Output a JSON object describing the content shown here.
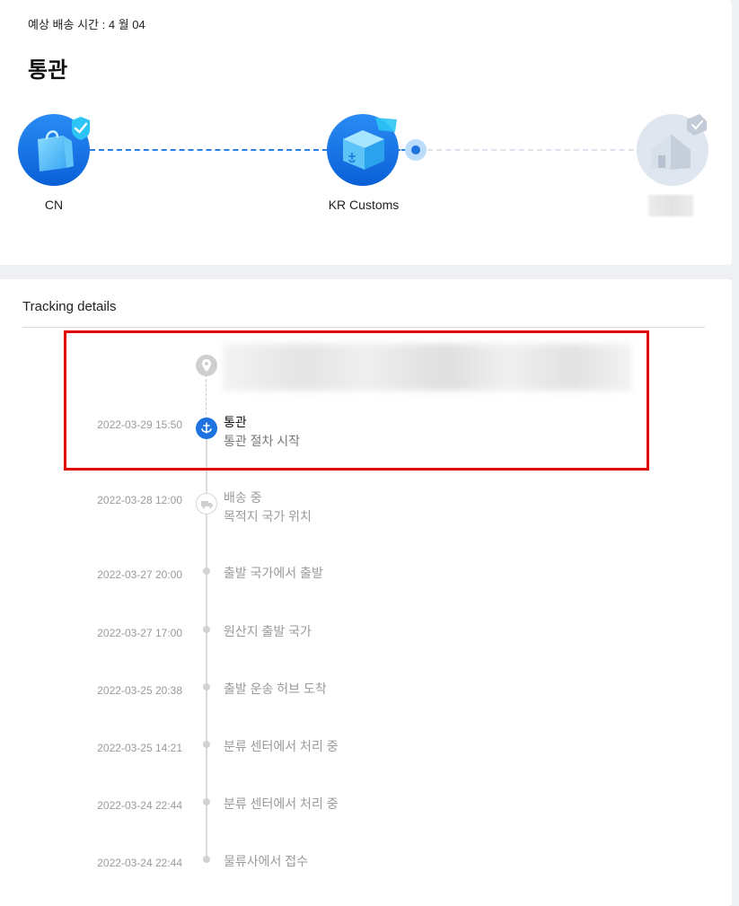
{
  "header": {
    "eta_text": "예상 배송 시간 : 4 월 04",
    "status_title": "통관"
  },
  "stages": [
    {
      "label": "CN",
      "icon": "shopping-bag-icon",
      "state": "done"
    },
    {
      "label": "KR Customs",
      "icon": "customs-package-icon",
      "state": "current"
    },
    {
      "label": "",
      "icon": "house-icon",
      "state": "pending"
    }
  ],
  "tracking": {
    "title": "Tracking details",
    "events": [
      {
        "time": "2022-03-29 15:50",
        "title": "통관",
        "sub": "통관 절차 시작",
        "icon": "anchor-icon",
        "active": true
      },
      {
        "time": "2022-03-28 12:00",
        "title": "배송 중",
        "sub": "목적지 국가 위치",
        "icon": "truck-icon",
        "active": false
      },
      {
        "time": "2022-03-27 20:00",
        "title": "출발 국가에서 출발",
        "sub": "",
        "active": false
      },
      {
        "time": "2022-03-27 17:00",
        "title": "원산지 출발 국가",
        "sub": "",
        "active": false
      },
      {
        "time": "2022-03-25 20:38",
        "title": "출발 운송 허브 도착",
        "sub": "",
        "active": false
      },
      {
        "time": "2022-03-25 14:21",
        "title": "분류 센터에서 처리 중",
        "sub": "",
        "active": false
      },
      {
        "time": "2022-03-24 22:44",
        "title": "분류 센터에서 처리 중",
        "sub": "",
        "active": false
      },
      {
        "time": "2022-03-24 22:44",
        "title": "물류사에서 접수",
        "sub": "",
        "active": false
      }
    ]
  },
  "colors": {
    "accent": "#1f73e0",
    "highlight": "#e00000",
    "muted": "#9a9a9a"
  }
}
